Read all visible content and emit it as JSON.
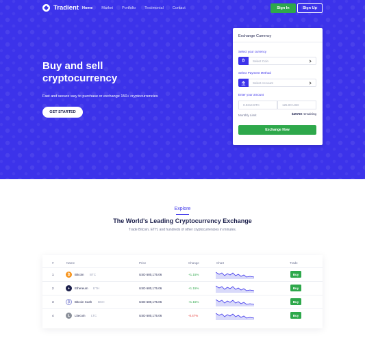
{
  "nav": {
    "brand": "Tradient",
    "links": [
      "Home",
      "Market",
      "Portfolio",
      "Testimonial",
      "Contact"
    ],
    "signin": "Sign In",
    "signup": "Sign Up"
  },
  "hero": {
    "title": "Buy and sell cryptocurrency",
    "subtitle": "Fast and secure way to purchase or exchange 150+ cryptocurrencies",
    "cta": "GET STARTED"
  },
  "exchange": {
    "title": "Exchange Currency",
    "currency_label": "Select your currency",
    "coin_placeholder": "Select Coin",
    "coin_icon": "₿",
    "payment_label": "Select Payment Method",
    "account_placeholder": "Select Account",
    "account_icon": "bank-icon",
    "amount_label": "Enter your amount",
    "amount_btc": "0.0214 BTC",
    "amount_usd": "125.00 USD",
    "limit_label": "Monthly Limit",
    "limit_value": "$49750",
    "limit_suffix": "remaining",
    "submit": "Exchange Now"
  },
  "explore": {
    "tag": "Explore",
    "title": "The World's Leading Cryptocurrency Exchange",
    "subtitle": "Trade Bitcoin, ETH, and hundreds of other cryptocurrencies in minutes."
  },
  "table": {
    "headers": [
      "#",
      "Name",
      "Price",
      "Change",
      "Chart",
      "Trade"
    ],
    "rows": [
      {
        "num": "1",
        "name": "Bitcoin",
        "symbol": "BTC",
        "price": "USD 680,175.06",
        "change": "+1.15%",
        "trade": "Buy",
        "icon_color": "#f7931a",
        "icon_glyph": "₿"
      },
      {
        "num": "2",
        "name": "Ethereum",
        "symbol": "ETH",
        "price": "USD 680,175.06",
        "change": "+1.15%",
        "trade": "Buy",
        "icon_color": "#1b1f4b",
        "icon_glyph": "♦"
      },
      {
        "num": "3",
        "name": "Bitcoin Cash",
        "symbol": "BCH",
        "price": "USD 680,175.06",
        "change": "+1.15%",
        "trade": "Buy",
        "icon_color": "#8b8fd6",
        "icon_glyph": "₿"
      },
      {
        "num": "4",
        "name": "Litecoin",
        "symbol": "LTC",
        "price": "USD 680,175.06",
        "change": "-0.47%",
        "trade": "Buy",
        "icon_color": "#8a8f99",
        "icon_glyph": "Ł"
      }
    ]
  },
  "colors": {
    "brand": "#3c33ea",
    "green": "#2ea84b",
    "red": "#e53935",
    "dark": "#1b1f4b"
  }
}
